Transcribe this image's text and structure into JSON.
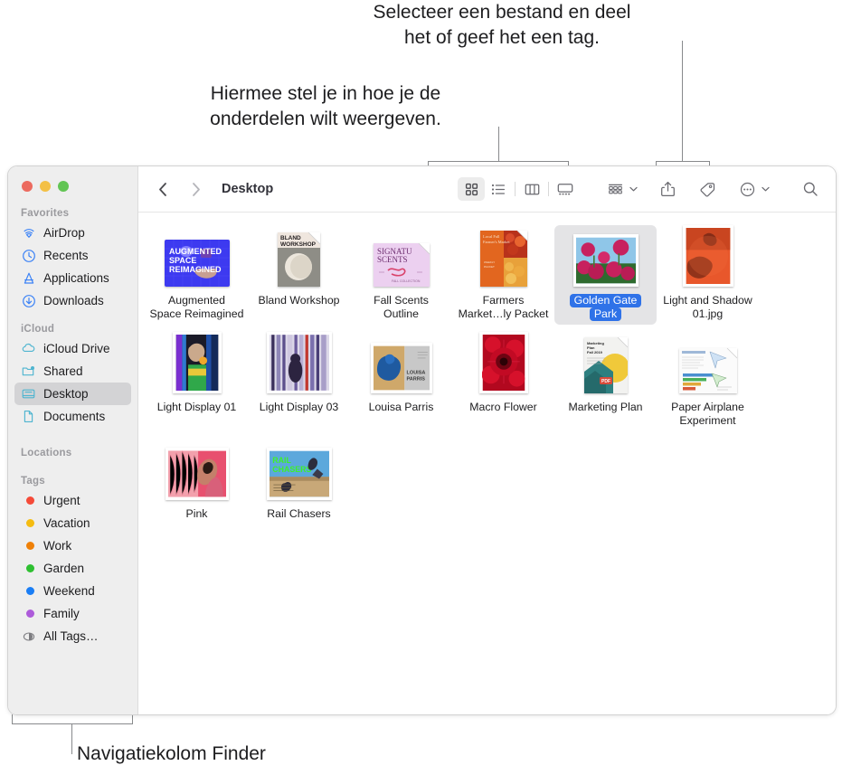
{
  "annotations": {
    "share_tag": "Selecteer een bestand en deel\nhet of geef het een tag.",
    "view_options": "Hiermee stel je in hoe je de\nonderdelen wilt weergeven.",
    "sidebar": "Navigatiekolom Finder"
  },
  "window": {
    "traffic_lights": {
      "close": "close-red",
      "minimize": "minimize-yellow",
      "zoom": "zoom-green",
      "colors": {
        "close": "#ec6a5f",
        "minimize": "#f3c045",
        "zoom": "#62c554"
      }
    }
  },
  "toolbar": {
    "back_label": "back-icon",
    "forward_label": "forward-icon",
    "path_title": "Desktop",
    "view_buttons": [
      {
        "name": "icon-view",
        "label": "grid-view-icon",
        "active": true
      },
      {
        "name": "list-view",
        "label": "list-view-icon",
        "active": false
      },
      {
        "name": "column-view",
        "label": "column-view-icon",
        "active": false
      },
      {
        "name": "gallery-view",
        "label": "gallery-view-icon",
        "active": false
      }
    ],
    "group_button": "group-items-icon",
    "share_button": "share-icon",
    "tag_button": "tag-icon",
    "more_button": "more-actions-icon",
    "search_button": "search-icon"
  },
  "sidebar": {
    "sections": [
      {
        "title": "Favorites",
        "items": [
          {
            "label": "AirDrop",
            "icon": "airdrop-icon",
            "selected": false
          },
          {
            "label": "Recents",
            "icon": "recents-icon",
            "selected": false
          },
          {
            "label": "Applications",
            "icon": "applications-icon",
            "selected": false
          },
          {
            "label": "Downloads",
            "icon": "downloads-icon",
            "selected": false
          }
        ]
      },
      {
        "title": "iCloud",
        "items": [
          {
            "label": "iCloud Drive",
            "icon": "cloud-icon",
            "selected": false
          },
          {
            "label": "Shared",
            "icon": "shared-folder-icon",
            "selected": false
          },
          {
            "label": "Desktop",
            "icon": "desktop-icon",
            "selected": true
          },
          {
            "label": "Documents",
            "icon": "document-icon",
            "selected": false
          }
        ]
      },
      {
        "title": "Locations",
        "items": []
      },
      {
        "title": "Tags",
        "items": [
          {
            "label": "Urgent",
            "icon": "tag-dot",
            "color": "#f54a38",
            "selected": false
          },
          {
            "label": "Vacation",
            "icon": "tag-dot",
            "color": "#f5bc11",
            "selected": false
          },
          {
            "label": "Work",
            "icon": "tag-dot",
            "color": "#ef8007",
            "selected": false
          },
          {
            "label": "Garden",
            "icon": "tag-dot",
            "color": "#2ec031",
            "selected": false
          },
          {
            "label": "Weekend",
            "icon": "tag-dot",
            "color": "#1a7ef5",
            "selected": false
          },
          {
            "label": "Family",
            "icon": "tag-dot",
            "color": "#ad5bda",
            "selected": false
          },
          {
            "label": "All Tags…",
            "icon": "all-tags-icon",
            "color": "",
            "selected": false
          }
        ]
      }
    ]
  },
  "files": [
    {
      "name_lines": [
        "Augmented",
        "Space Reimagined"
      ],
      "tag_color": "",
      "selected": false,
      "kind": "image",
      "thumb": "augmented-space-reimagined"
    },
    {
      "name_lines": [
        "Bland Workshop"
      ],
      "tag_color": "",
      "selected": false,
      "kind": "doc",
      "thumb": "bland-workshop"
    },
    {
      "name_lines": [
        "Fall Scents",
        "Outline"
      ],
      "tag_color": "#5fd35f",
      "selected": false,
      "kind": "doc",
      "thumb": "fall-scents-outline"
    },
    {
      "name_lines": [
        "Farmers",
        "Market…ly Packet"
      ],
      "tag_color": "#5fd35f",
      "selected": false,
      "kind": "doc",
      "thumb": "farmers-market-packet"
    },
    {
      "name_lines": [
        "Golden Gate",
        "Park"
      ],
      "tag_color": "#5fd35f",
      "selected": true,
      "kind": "photo",
      "thumb": "golden-gate-park"
    },
    {
      "name_lines": [
        "Light and Shadow",
        "01.jpg"
      ],
      "tag_color": "",
      "selected": false,
      "kind": "photo",
      "thumb": "light-and-shadow-01"
    },
    {
      "name_lines": [
        "Light Display 01"
      ],
      "tag_color": "",
      "selected": false,
      "kind": "photo",
      "thumb": "light-display-01"
    },
    {
      "name_lines": [
        "Light Display 03"
      ],
      "tag_color": "",
      "selected": false,
      "kind": "photo",
      "thumb": "light-display-03"
    },
    {
      "name_lines": [
        "Louisa Parris"
      ],
      "tag_color": "",
      "selected": false,
      "kind": "photo",
      "thumb": "louisa-parris"
    },
    {
      "name_lines": [
        "Macro Flower"
      ],
      "tag_color": "#5fd35f",
      "selected": false,
      "kind": "photo",
      "thumb": "macro-flower"
    },
    {
      "name_lines": [
        "Marketing Plan"
      ],
      "tag_color": "",
      "selected": false,
      "kind": "doc",
      "thumb": "marketing-plan"
    },
    {
      "name_lines": [
        "Paper Airplane",
        "Experiment"
      ],
      "tag_color": "",
      "selected": false,
      "kind": "doc",
      "thumb": "paper-airplane-experiment"
    },
    {
      "name_lines": [
        "Pink"
      ],
      "tag_color": "",
      "selected": false,
      "kind": "photo",
      "thumb": "pink"
    },
    {
      "name_lines": [
        "Rail Chasers"
      ],
      "tag_color": "",
      "selected": false,
      "kind": "photo",
      "thumb": "rail-chasers"
    }
  ]
}
